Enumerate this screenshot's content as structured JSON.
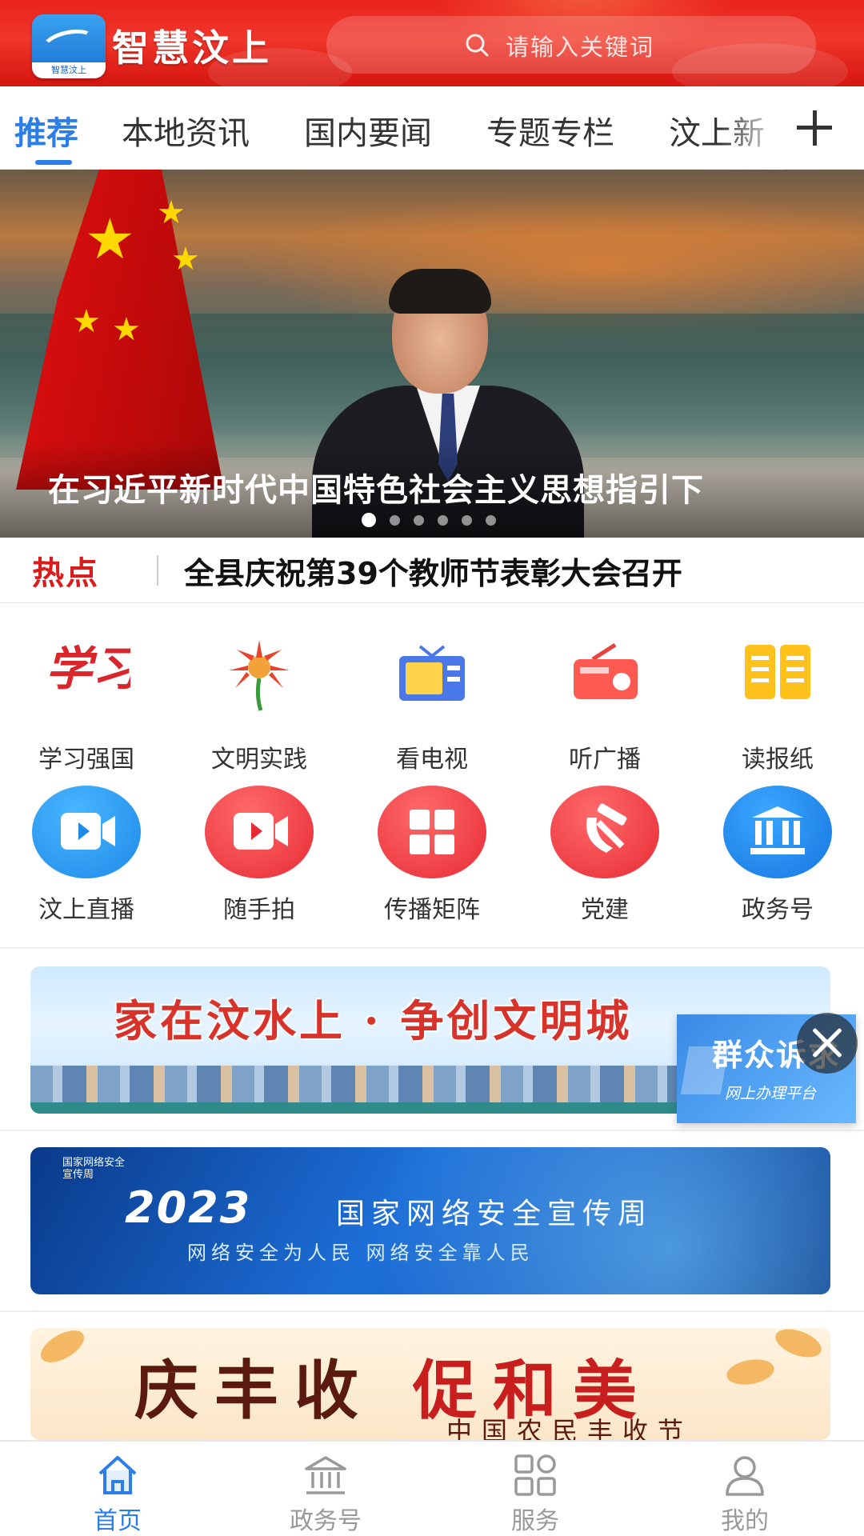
{
  "header": {
    "app_title": "智慧汶上",
    "logo_caption": "智慧汶上",
    "search_placeholder": "请输入关键词",
    "colors": {
      "header_red": "#e8231c",
      "accent_blue": "#2b7de9"
    }
  },
  "tabs": [
    {
      "label": "推荐",
      "active": true
    },
    {
      "label": "本地资讯",
      "active": false
    },
    {
      "label": "国内要闻",
      "active": false
    },
    {
      "label": "专题专栏",
      "active": false
    },
    {
      "label": "汶上新",
      "active": false
    }
  ],
  "tab_more_icon": "plus-icon",
  "banner": {
    "caption": "在习近平新时代中国特色社会主义思想指引下",
    "slide_count": 6,
    "active_slide": 1
  },
  "hot": {
    "label": "热点",
    "headline": "全县庆祝第39个教师节表彰大会召开"
  },
  "grid": [
    {
      "label": "学习强国",
      "icon": "xuexi-logo-icon"
    },
    {
      "label": "文明实践",
      "icon": "civilization-flower-icon"
    },
    {
      "label": "看电视",
      "icon": "tv-icon"
    },
    {
      "label": "听广播",
      "icon": "radio-icon"
    },
    {
      "label": "读报纸",
      "icon": "newspaper-book-icon"
    },
    {
      "label": "汶上直播",
      "icon": "live-video-icon"
    },
    {
      "label": "随手拍",
      "icon": "camera-video-icon"
    },
    {
      "label": "传播矩阵",
      "icon": "matrix-grid-icon"
    },
    {
      "label": "党建",
      "icon": "hammer-sickle-icon"
    },
    {
      "label": "政务号",
      "icon": "government-building-icon"
    }
  ],
  "ads": {
    "ad1_text": "家在汶水上 · 争创文明城",
    "ad2_year": "2023",
    "ad2_title": "国家网络安全宣传周",
    "ad2_subtitle": "网络安全为人民  网络安全靠人民",
    "ad2_badge": "国家网络安全\n宣传周",
    "ad3_text_a": "庆丰收",
    "ad3_text_b": "促和美",
    "ad3_sub": "中国农民丰收节"
  },
  "float_widget": {
    "title": "群众诉求",
    "subtitle": "网上办理平台"
  },
  "bottom_nav": [
    {
      "label": "首页",
      "icon": "home-icon",
      "active": true
    },
    {
      "label": "政务号",
      "icon": "government-building-icon",
      "active": false
    },
    {
      "label": "服务",
      "icon": "apps-grid-icon",
      "active": false
    },
    {
      "label": "我的",
      "icon": "user-icon",
      "active": false
    }
  ]
}
